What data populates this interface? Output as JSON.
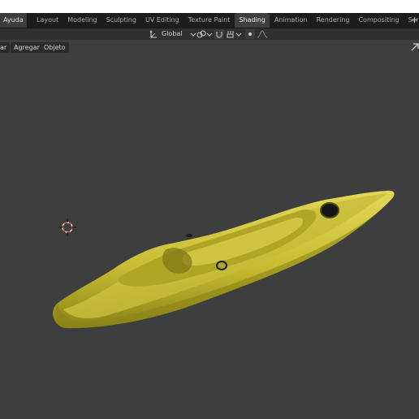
{
  "menu": {
    "help_label": "Ayuda"
  },
  "workspace_tabs": [
    {
      "label": "Layout",
      "active": false
    },
    {
      "label": "Modeling",
      "active": false
    },
    {
      "label": "Sculpting",
      "active": false
    },
    {
      "label": "UV Editing",
      "active": false
    },
    {
      "label": "Texture Paint",
      "active": false
    },
    {
      "label": "Shading",
      "active": true
    },
    {
      "label": "Animation",
      "active": false
    },
    {
      "label": "Rendering",
      "active": false
    },
    {
      "label": "Compositing",
      "active": false
    },
    {
      "label": "Scripting",
      "active": false
    }
  ],
  "add_workspace_label": "+",
  "header": {
    "orientation": "Global",
    "icons": [
      "transform-orientation-icon",
      "pivot-chain-icon",
      "snap-magnet-icon",
      "snap-target-icon",
      "proportional-edit-icon",
      "falloff-curve-icon"
    ]
  },
  "viewport_menu": {
    "partial_label": "ar",
    "add_label": "Agregar",
    "object_label": "Objeto"
  },
  "colors": {
    "kayak_body": "#cbc13a",
    "viewport_bg": "#3e3e3e",
    "active_tab": "#3f3f3f",
    "cursor_red": "#e04a3a"
  }
}
